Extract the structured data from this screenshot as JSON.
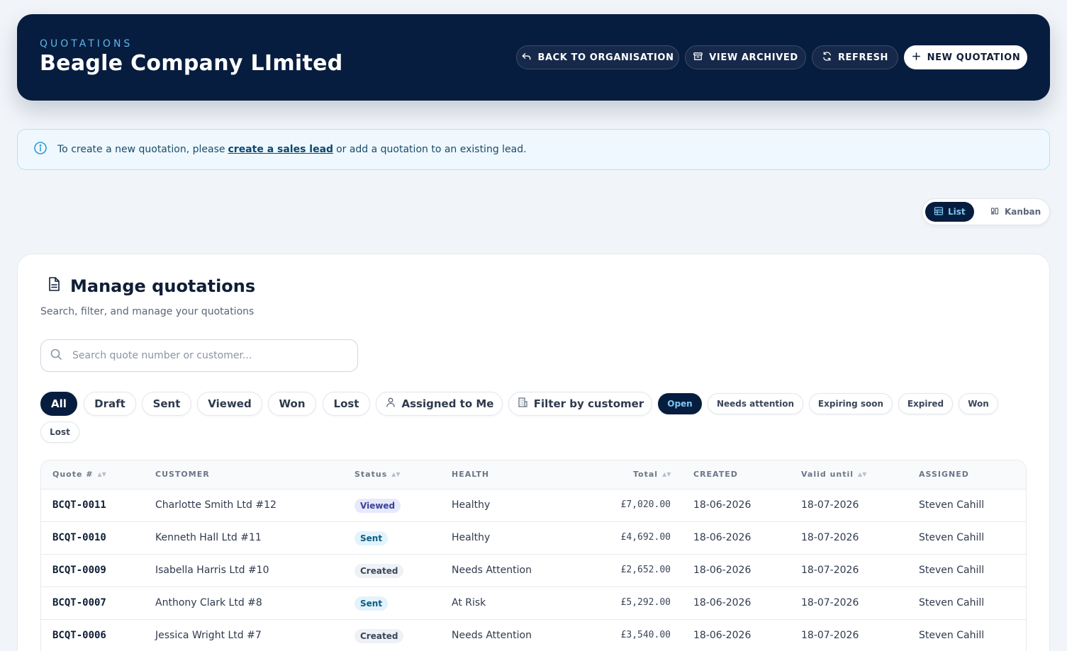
{
  "header": {
    "eyebrow": "QUOTATIONS",
    "title": "Beagle Company LImited",
    "buttons": {
      "back": "BACK TO ORGANISATION",
      "archived": "VIEW ARCHIVED",
      "refresh": "REFRESH",
      "new": "NEW QUOTATION"
    }
  },
  "banner": {
    "text_before": "To create a new quotation, please",
    "link": "create a sales lead",
    "text_after": "or add a quotation to an existing lead."
  },
  "view_toggle": {
    "list": "List",
    "kanban": "Kanban",
    "active": "List"
  },
  "card": {
    "title": "Manage quotations",
    "subtitle": "Search, filter, and manage your quotations",
    "search_placeholder": "Search quote number or customer..."
  },
  "status_filters": [
    "All",
    "Draft",
    "Sent",
    "Viewed",
    "Won",
    "Lost"
  ],
  "assigned_filter": "Assigned to Me",
  "customer_filter": "Filter by customer",
  "health_filters": [
    "Open",
    "Needs attention",
    "Expiring soon",
    "Expired",
    "Won",
    "Lost"
  ],
  "table": {
    "columns": [
      "Quote #",
      "CUSTOMER",
      "Status",
      "HEALTH",
      "Total",
      "CREATED",
      "Valid until",
      "ASSIGNED"
    ],
    "rows": [
      {
        "quote": "BCQT-0011",
        "customer": "Charlotte Smith Ltd #12",
        "status": "Viewed",
        "health": "Healthy",
        "total": "£7,020.00",
        "created": "18-06-2026",
        "valid": "18-07-2026",
        "assigned": "Steven Cahill"
      },
      {
        "quote": "BCQT-0010",
        "customer": "Kenneth Hall Ltd #11",
        "status": "Sent",
        "health": "Healthy",
        "total": "£4,692.00",
        "created": "18-06-2026",
        "valid": "18-07-2026",
        "assigned": "Steven Cahill"
      },
      {
        "quote": "BCQT-0009",
        "customer": "Isabella Harris Ltd #10",
        "status": "Created",
        "health": "Needs Attention",
        "total": "£2,652.00",
        "created": "18-06-2026",
        "valid": "18-07-2026",
        "assigned": "Steven Cahill"
      },
      {
        "quote": "BCQT-0007",
        "customer": "Anthony Clark Ltd #8",
        "status": "Sent",
        "health": "At Risk",
        "total": "£5,292.00",
        "created": "18-06-2026",
        "valid": "18-07-2026",
        "assigned": "Steven Cahill"
      },
      {
        "quote": "BCQT-0006",
        "customer": "Jessica Wright Ltd #7",
        "status": "Created",
        "health": "Needs Attention",
        "total": "£3,540.00",
        "created": "18-06-2026",
        "valid": "18-07-2026",
        "assigned": "Steven Cahill"
      }
    ]
  }
}
